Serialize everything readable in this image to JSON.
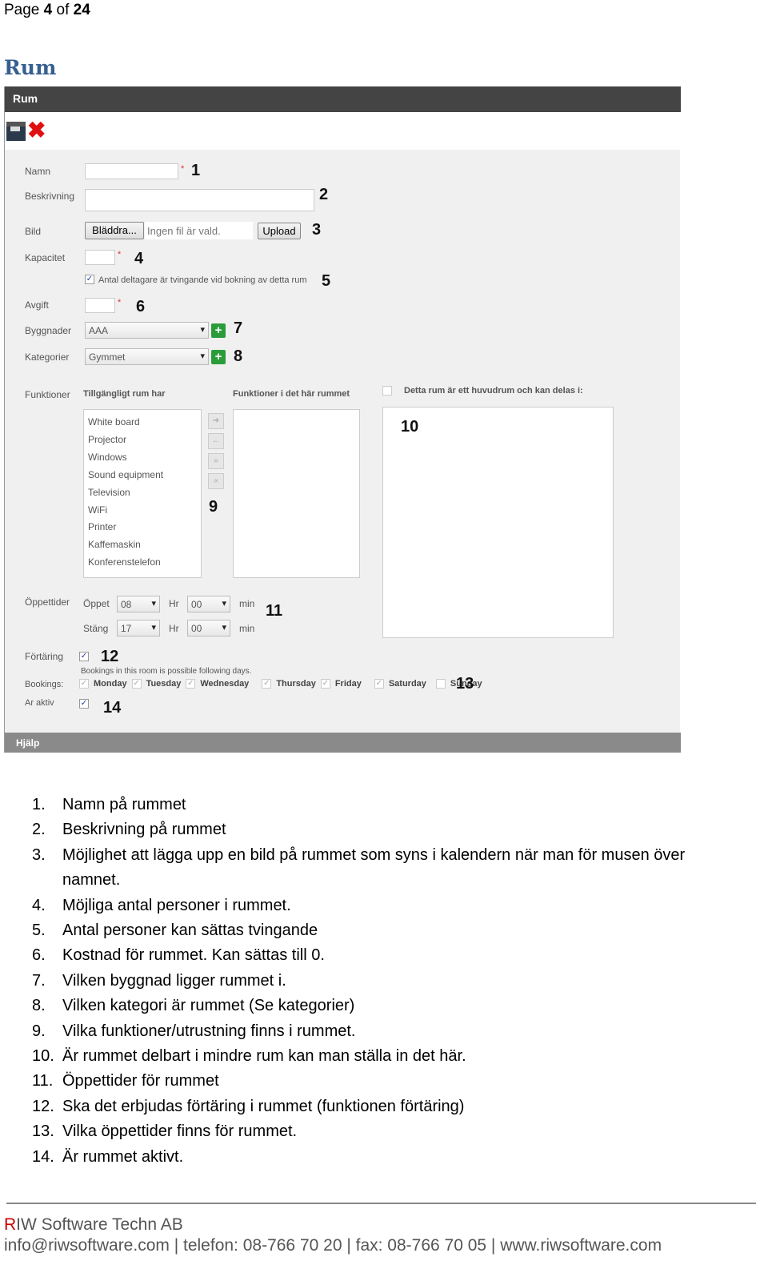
{
  "page": {
    "label": "Page",
    "current": "4",
    "of": "of",
    "total": "24"
  },
  "heading": "Rum",
  "window": {
    "title": "Rum",
    "toolbar": {
      "save_icon": "floppy-disk-icon",
      "delete_icon": "red-x-icon"
    },
    "form": {
      "namn_label": "Namn",
      "beskrivning_label": "Beskrivning",
      "bild_label": "Bild",
      "browse_button": "Bläddra...",
      "no_file": "Ingen fil är vald.",
      "upload_button": "Upload",
      "kapacitet_label": "Kapacitet",
      "mandatory_checkbox": "Antal deltagare är tvingande vid bokning av detta rum",
      "avgift_label": "Avgift",
      "byggnader_label": "Byggnader",
      "byggnader_value": "AAA",
      "kategorier_label": "Kategorier",
      "kategorier_value": "Gymmet",
      "funktioner_label": "Funktioner",
      "available_header": "Tillgängligt rum har",
      "room_header": "Funktioner i det här rummet",
      "main_room_label": "Detta rum är ett huvudrum och kan delas i:",
      "available_items": [
        "White board",
        "Projector",
        "Windows",
        "Sound equipment",
        "Television",
        "WiFi",
        "Printer",
        "Kaffemaskin",
        "Konferenstelefon"
      ],
      "oppettider_label": "Öppettider",
      "open_label": "Öppet",
      "open_hr": "08",
      "open_min": "00",
      "close_label": "Stäng",
      "close_hr": "17",
      "close_min": "00",
      "hr": "Hr",
      "min": "min",
      "fortaring_label": "Förtäring",
      "bookings_note": "Bookings in this room is possible following days.",
      "bookings_label": "Bookings:",
      "days": [
        {
          "name": "Monday",
          "checked": true
        },
        {
          "name": "Tuesday",
          "checked": true
        },
        {
          "name": "Wednesday",
          "checked": true
        },
        {
          "name": "Thursday",
          "checked": true
        },
        {
          "name": "Friday",
          "checked": true
        },
        {
          "name": "Saturday",
          "checked": true
        },
        {
          "name": "Sunday",
          "checked": false
        }
      ],
      "active_label": "Ar aktiv"
    },
    "markers": [
      "1",
      "2",
      "3",
      "4",
      "5",
      "6",
      "7",
      "8",
      "9",
      "10",
      "11",
      "12",
      "13",
      "14"
    ],
    "footer": "Hjälp"
  },
  "list": [
    {
      "n": "1.",
      "t": "Namn på rummet"
    },
    {
      "n": "2.",
      "t": "Beskrivning på rummet"
    },
    {
      "n": "3.",
      "t": "Möjlighet att lägga upp en bild på rummet som syns i kalendern när man för musen över namnet."
    },
    {
      "n": "4.",
      "t": "Möjliga antal personer i rummet."
    },
    {
      "n": "5.",
      "t": "Antal personer kan sättas tvingande"
    },
    {
      "n": "6.",
      "t": "Kostnad för rummet. Kan sättas till 0."
    },
    {
      "n": "7.",
      "t": "Vilken byggnad ligger rummet i."
    },
    {
      "n": "8.",
      "t": "Vilken kategori är rummet (Se kategorier)"
    },
    {
      "n": "9.",
      "t": "Vilka funktioner/utrustning finns i rummet."
    },
    {
      "n": "10.",
      "t": "Är rummet delbart i mindre rum kan man ställa in det här."
    },
    {
      "n": "11.",
      "t": "Öppettider för rummet"
    },
    {
      "n": "12.",
      "t": "Ska det erbjudas förtäring i rummet (funktionen förtäring)"
    },
    {
      "n": "13.",
      "t": "Vilka öppettider finns för rummet."
    },
    {
      "n": "14.",
      "t": "Är rummet aktivt."
    }
  ],
  "footer": {
    "company_initial": "R",
    "company_rest": "IW Software Techn AB",
    "contact": "info@riwsoftware.com | telefon: 08-766 70 20 | fax: 08-766 70 05 | www.riwsoftware.com"
  }
}
